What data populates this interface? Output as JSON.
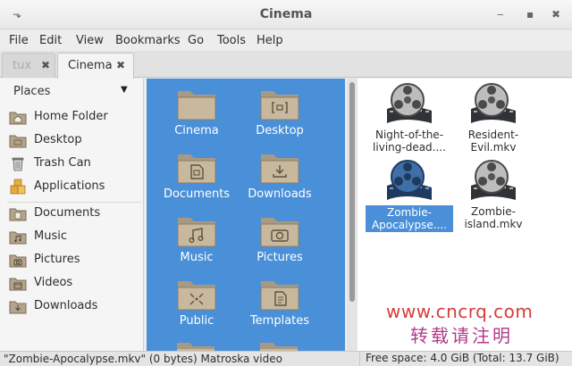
{
  "window": {
    "title": "Cinema",
    "menu_icon": "⬎",
    "minimize": "‒",
    "maximize": "▪",
    "close": "✖"
  },
  "menu": [
    "File",
    "Edit",
    "View",
    "Bookmarks",
    "Go",
    "Tools",
    "Help"
  ],
  "tabs": [
    {
      "label": "tux",
      "close": "✖"
    },
    {
      "label": "Cinema",
      "close": "✖"
    }
  ],
  "sidebar": {
    "header": "Places",
    "arrow": "▼",
    "items": [
      {
        "label": "Home Folder",
        "icon": "home-folder-icon"
      },
      {
        "label": "Desktop",
        "icon": "desktop-icon"
      },
      {
        "label": "Trash Can",
        "icon": "trash-icon"
      },
      {
        "label": "Applications",
        "icon": "applications-icon"
      },
      {
        "label": "Documents",
        "icon": "documents-icon"
      },
      {
        "label": "Music",
        "icon": "music-icon"
      },
      {
        "label": "Pictures",
        "icon": "pictures-icon"
      },
      {
        "label": "Videos",
        "icon": "videos-icon"
      },
      {
        "label": "Downloads",
        "icon": "downloads-icon"
      }
    ]
  },
  "tree": {
    "folders": [
      {
        "label": "Cinema",
        "emblem": "none"
      },
      {
        "label": "Desktop",
        "emblem": "desktop"
      },
      {
        "label": "Documents",
        "emblem": "document"
      },
      {
        "label": "Downloads",
        "emblem": "download"
      },
      {
        "label": "Music",
        "emblem": "music"
      },
      {
        "label": "Pictures",
        "emblem": "camera"
      },
      {
        "label": "Public",
        "emblem": "share"
      },
      {
        "label": "Templates",
        "emblem": "template"
      }
    ]
  },
  "files": [
    {
      "label": "Night-of-the-\nliving-dead....",
      "icon": "film-reel-icon",
      "selected": false
    },
    {
      "label": "Resident-\nEvil.mkv",
      "icon": "film-reel-icon",
      "selected": false
    },
    {
      "label": "Zombie-\nApocalypse....",
      "icon": "film-reel-icon",
      "selected": true
    },
    {
      "label": "Zombie-\nisland.mkv",
      "icon": "film-reel-icon",
      "selected": false
    }
  ],
  "status": {
    "selection": "\"Zombie-Apocalypse.mkv\" (0 bytes) Matroska video",
    "free_space": "Free space: 4.0 GiB (Total: 13.7 GiB)"
  },
  "watermark": {
    "line1": "www.cncrq.com",
    "line2": "转载请注明"
  },
  "colors": {
    "selection_blue": "#4a90d9",
    "folder_tan": "#b5a48c"
  }
}
